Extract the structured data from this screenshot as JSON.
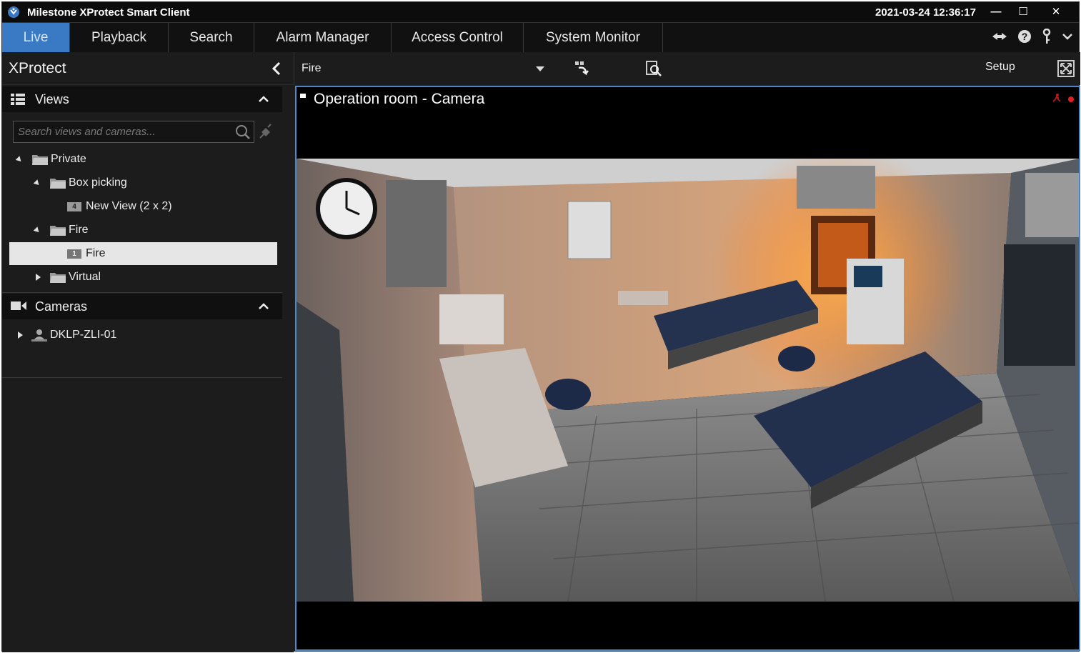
{
  "window": {
    "title": "Milestone XProtect Smart Client",
    "datetime": "2021-03-24 12:36:17",
    "minimize": "—",
    "maximize": "☐",
    "close": "✕"
  },
  "tabs": [
    {
      "label": "Live",
      "active": true
    },
    {
      "label": "Playback",
      "active": false
    },
    {
      "label": "Search",
      "active": false
    },
    {
      "label": "Alarm Manager",
      "active": false
    },
    {
      "label": "Access Control",
      "active": false
    },
    {
      "label": "System Monitor",
      "active": false
    }
  ],
  "header_icons": [
    "settings-arrow-icon",
    "help-icon",
    "key-icon",
    "chevron-down-icon"
  ],
  "left_panel": {
    "title": "XProtect",
    "views": {
      "label": "Views",
      "search_placeholder": "Search views and cameras...",
      "tree": [
        {
          "label": "Private",
          "level": 0,
          "expanded": true,
          "type": "folder"
        },
        {
          "label": "Box picking",
          "level": 1,
          "expanded": true,
          "type": "folder"
        },
        {
          "label": "New View (2 x 2)",
          "level": 2,
          "type": "view",
          "badge": "4"
        },
        {
          "label": "Fire",
          "level": 1,
          "expanded": true,
          "type": "folder"
        },
        {
          "label": "Fire",
          "level": 2,
          "type": "view",
          "badge": "1",
          "selected": true
        },
        {
          "label": "Virtual",
          "level": 1,
          "expanded": false,
          "type": "folder"
        }
      ]
    },
    "cameras": {
      "label": "Cameras",
      "tree": [
        {
          "label": "DKLP-ZLI-01",
          "expanded": false
        }
      ]
    }
  },
  "toolbar": {
    "current_view": "Fire",
    "setup_label": "Setup"
  },
  "viewport": {
    "camera_title": "Operation room - Camera"
  },
  "colors": {
    "accent": "#3a7ac4",
    "viewport_border": "#4a86c8",
    "recording": "#e02020"
  }
}
